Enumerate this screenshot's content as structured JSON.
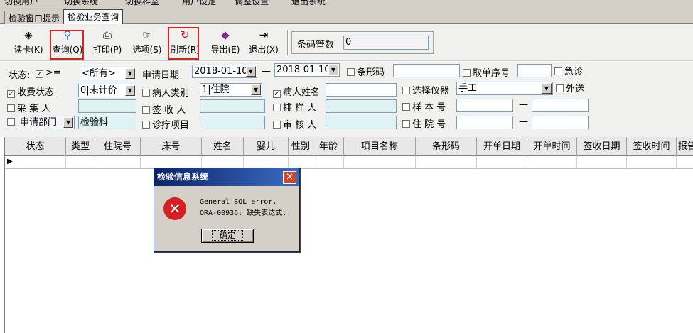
{
  "top_menu": {
    "items": [
      "切换用户",
      "切换系统",
      "切换科室",
      "用户设定",
      "调整设置",
      "退出系统"
    ]
  },
  "tabs": [
    {
      "label": "检验窗口提示"
    },
    {
      "label": "检验业务查询"
    }
  ],
  "toolbar": {
    "buttons": [
      {
        "label": "读卡(K)",
        "icon": "card-read-icon"
      },
      {
        "label": "查询(Q)",
        "icon": "search-icon"
      },
      {
        "label": "打印(P)",
        "icon": "printer-icon"
      },
      {
        "label": "选项(S)",
        "icon": "options-icon"
      },
      {
        "label": "刷新(R)",
        "icon": "refresh-icon"
      },
      {
        "label": "导出(E)",
        "icon": "export-icon"
      },
      {
        "label": "退出(X)",
        "icon": "exit-icon"
      }
    ],
    "barcode_count_label": "条码管数",
    "barcode_count_value": "0",
    "highlight_color": "#e02020"
  },
  "filters": {
    "status_label": "状态:",
    "status_op": ">=",
    "status_value": "<所有>",
    "apply_date_label": "申请日期",
    "date_from": "2018-01-10",
    "date_sep": "—",
    "date_to": "2018-01-10",
    "barcode_label": "条形码",
    "order_no_label": "取单序号",
    "urgent_label": "急诊",
    "fee_status_label": "收费状态",
    "fee_status_value": "0|未计价",
    "patient_type_label": "病人类别",
    "patient_type_value": "1|住院",
    "patient_name_label": "病人姓名",
    "instrument_label": "选择仪器",
    "instrument_value": "手工",
    "external_label": "外送",
    "collector_label": "采 集 人",
    "receiver_label": "签 收 人",
    "sorter_label": "排 样 人",
    "sample_no_label": "样 本 号",
    "sample_sep": "—",
    "dept_label": "申请部门",
    "dept_value": "检验科",
    "treatment_label": "诊疗项目",
    "reviewer_label": "审 核 人",
    "inpatient_no_label": "住 院 号",
    "inpatient_sep": "—"
  },
  "grid": {
    "columns": [
      "状态",
      "类型",
      "住院号",
      "床号",
      "姓名",
      "婴儿",
      "性别",
      "年龄",
      "项目名称",
      "条形码",
      "开单日期",
      "开单时间",
      "签收日期",
      "签收时间",
      "报告"
    ]
  },
  "dialog": {
    "title": "检验信息系统",
    "close": "✕",
    "line1": "General SQL error.",
    "line2": "ORA-00936: 缺失表达式.",
    "ok_label": "确定",
    "icon": "error-icon"
  }
}
